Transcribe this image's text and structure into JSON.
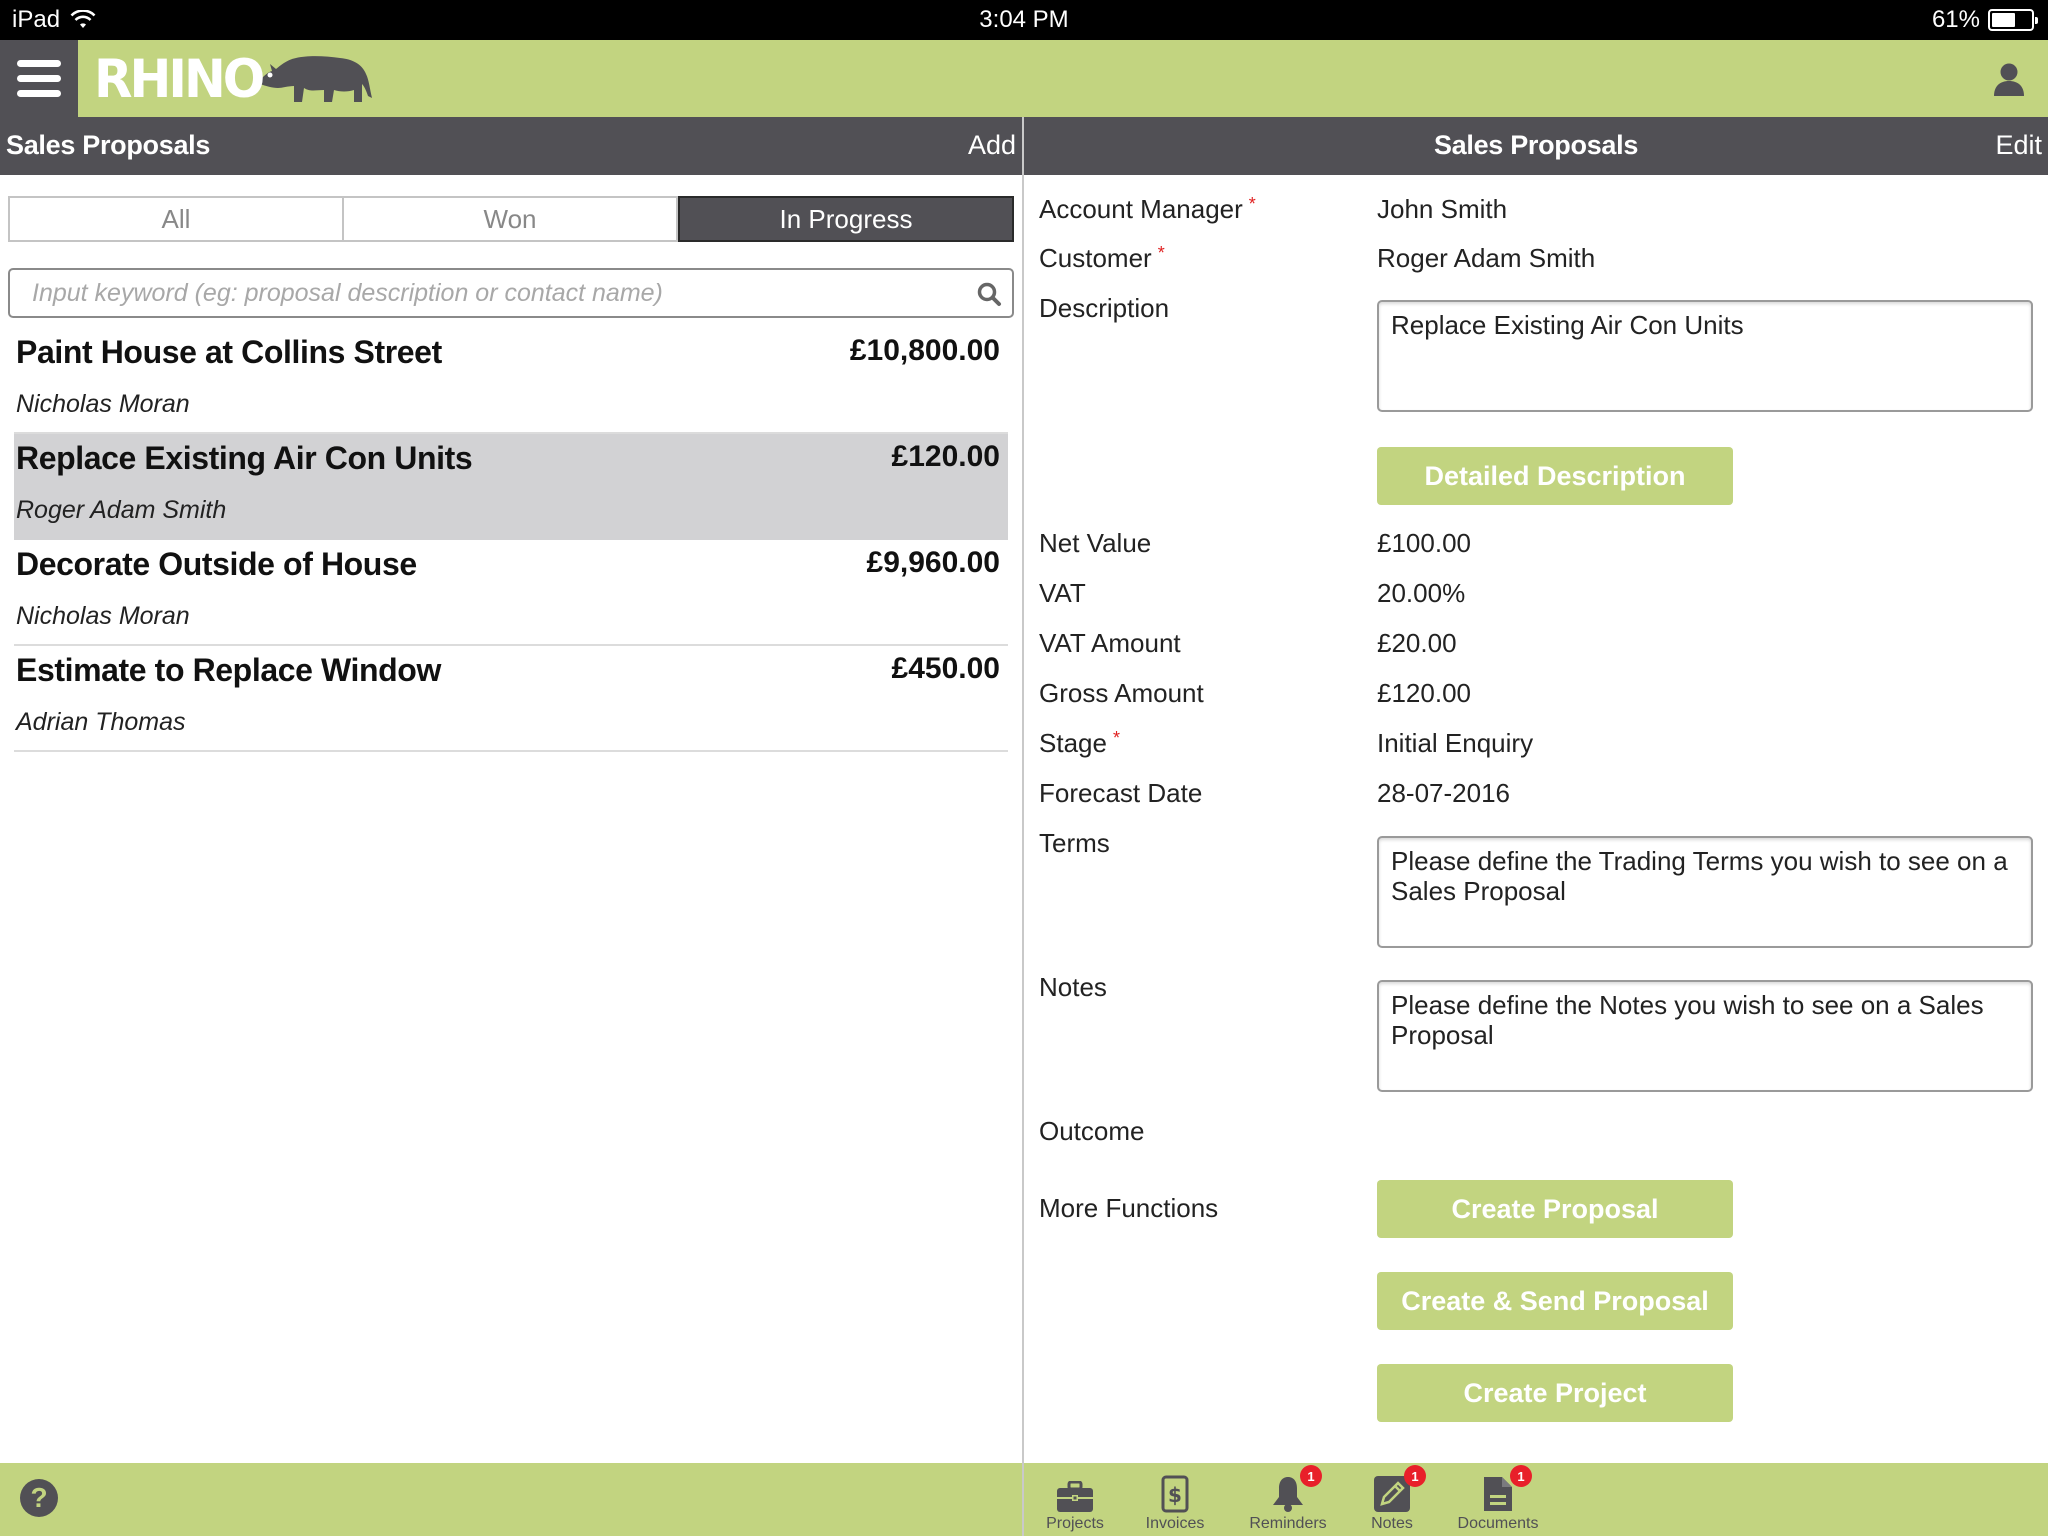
{
  "status_bar": {
    "device": "iPad",
    "time": "3:04 PM",
    "battery_percent_label": "61%",
    "battery_level": 0.61
  },
  "app": {
    "logo_text": "RHINO",
    "brand_color": "#c2d480",
    "dark_color": "#515055"
  },
  "left_panel": {
    "title": "Sales Proposals",
    "action_label": "Add",
    "segments": [
      {
        "label": "All",
        "active": false
      },
      {
        "label": "Won",
        "active": false
      },
      {
        "label": "In Progress",
        "active": true
      }
    ],
    "search": {
      "value": "",
      "placeholder": "Input keyword (eg: proposal description or contact name)"
    },
    "proposals": [
      {
        "title": "Paint House at Collins Street",
        "amount": "£10,800.00",
        "contact": "Nicholas Moran",
        "selected": false
      },
      {
        "title": "Replace Existing Air Con Units",
        "amount": "£120.00",
        "contact": "Roger Adam Smith",
        "selected": true
      },
      {
        "title": "Decorate Outside of House",
        "amount": "£9,960.00",
        "contact": "Nicholas Moran",
        "selected": false
      },
      {
        "title": "Estimate to Replace Window",
        "amount": "£450.00",
        "contact": "Adrian Thomas",
        "selected": false
      }
    ]
  },
  "right_panel": {
    "title": "Sales Proposals",
    "action_label": "Edit",
    "fields": {
      "account_manager": {
        "label": "Account Manager",
        "required": true,
        "value": "John Smith"
      },
      "customer": {
        "label": "Customer",
        "required": true,
        "value": "Roger Adam Smith"
      },
      "description": {
        "label": "Description",
        "value": "Replace Existing Air Con Units"
      },
      "detailed_description_button": "Detailed Description",
      "net_value": {
        "label": "Net Value",
        "value": "£100.00"
      },
      "vat": {
        "label": "VAT",
        "value": "20.00%"
      },
      "vat_amount": {
        "label": "VAT Amount",
        "value": "£20.00"
      },
      "gross_amount": {
        "label": "Gross Amount",
        "value": "£120.00"
      },
      "stage": {
        "label": "Stage",
        "required": true,
        "value": "Initial Enquiry"
      },
      "forecast_date": {
        "label": "Forecast Date",
        "value": "28-07-2016"
      },
      "terms": {
        "label": "Terms",
        "value": "Please define the Trading Terms you wish to see on a Sales Proposal"
      },
      "notes": {
        "label": "Notes",
        "value": "Please define the Notes you wish to see on a Sales Proposal"
      },
      "outcome": {
        "label": "Outcome",
        "value": ""
      },
      "more_functions": {
        "label": "More Functions"
      }
    },
    "buttons": {
      "create_proposal": "Create Proposal",
      "create_send_proposal": "Create & Send Proposal",
      "create_project": "Create Project"
    },
    "required_marker": "*"
  },
  "bottom_bar": {
    "help_icon": "?",
    "tabs": [
      {
        "label": "Projects",
        "icon": "briefcase-icon",
        "badge": null
      },
      {
        "label": "Invoices",
        "icon": "invoice-dollar-icon",
        "badge": null
      },
      {
        "label": "Reminders",
        "icon": "bell-icon",
        "badge": "1"
      },
      {
        "label": "Notes",
        "icon": "pencil-square-icon",
        "badge": "1"
      },
      {
        "label": "Documents",
        "icon": "document-icon",
        "badge": "1"
      }
    ]
  }
}
